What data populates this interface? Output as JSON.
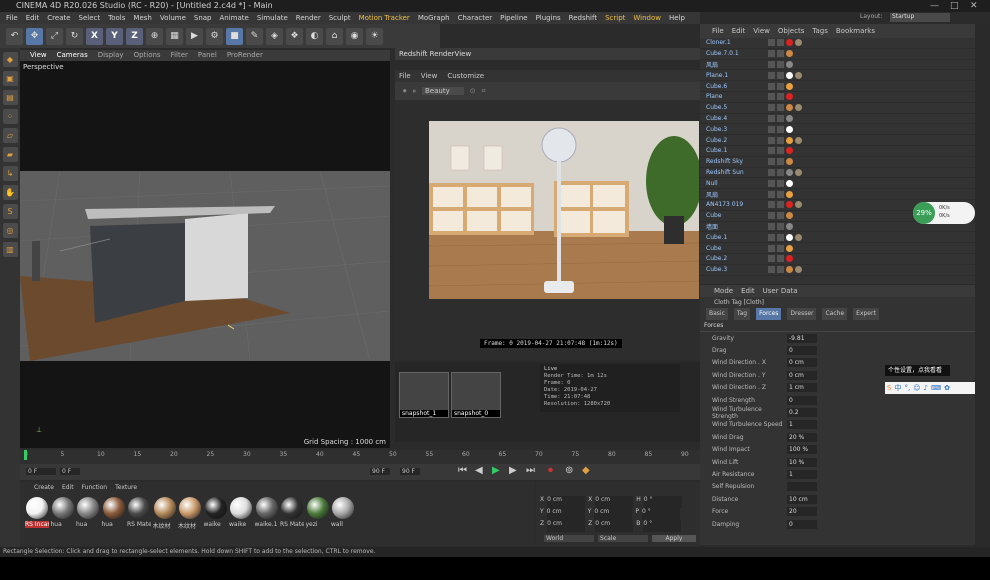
{
  "window": {
    "title": "CINEMA 4D R20.026 Studio (RC - R20) - [Untitled 2.c4d *] - Main",
    "layout_label": "Layout:",
    "layout_value": "Startup"
  },
  "menu": [
    "File",
    "Edit",
    "Create",
    "Select",
    "Tools",
    "Mesh",
    "Volume",
    "Snap",
    "Animate",
    "Simulate",
    "Render",
    "Sculpt",
    "Motion Tracker",
    "MoGraph",
    "Character",
    "Pipeline",
    "Plugins",
    "Redshift",
    "Script",
    "Window",
    "Help"
  ],
  "viewport": {
    "menu": [
      "View",
      "Cameras",
      "Display",
      "Options",
      "Filter",
      "Panel",
      "ProRender"
    ],
    "label": "Perspective",
    "grid_spacing": "Grid Spacing : 1000 cm"
  },
  "renderview": {
    "title": "Redshift RenderView",
    "menu": [
      "File",
      "View",
      "Customize"
    ],
    "preset": "Beauty",
    "frame_info": "Frame:  0   2019-04-27  21:07:48   (1m:12s)"
  },
  "snapshots": [
    {
      "label": "snapshot_1"
    },
    {
      "label": "snapshot_0"
    }
  ],
  "log": {
    "title": "Live",
    "lines": [
      "Render Time: 1m 12s",
      "Frame: 0",
      "Date: 2019-04-27",
      "Time: 21:07:48",
      "Resolution: 1280x720"
    ]
  },
  "objects": {
    "tabs": [
      "File",
      "Edit",
      "View",
      "Objects",
      "Tags",
      "Bookmarks"
    ],
    "items": [
      "Cloner.1",
      "Cube.7.0.1",
      "风扇",
      "Plane.1",
      "Cube.6",
      "Plane",
      "Cube.5",
      "Cube.4",
      "Cube.3",
      "Cube.2",
      "Cube.1",
      "Redshift Sky",
      "Redshift Sun",
      "Null",
      "风扇",
      "AN4173 019",
      "Cube",
      "墙面",
      "Cube.1",
      "Cube",
      "Cube.2",
      "Cube.3"
    ]
  },
  "attributes": {
    "menu": [
      "Mode",
      "Edit",
      "User Data"
    ],
    "tag_title": "Cloth Tag [Cloth]",
    "tabs": [
      "Basic",
      "Tag",
      "Forces",
      "Dresser",
      "Cache",
      "Expert"
    ],
    "active_tab": "Forces",
    "section": "Forces",
    "rows": [
      {
        "label": "Gravity",
        "value": "-9.81"
      },
      {
        "label": "Drag",
        "value": "0"
      },
      {
        "label": "Wind Direction . X",
        "value": "0 cm"
      },
      {
        "label": "Wind Direction . Y",
        "value": "0 cm"
      },
      {
        "label": "Wind Direction . Z",
        "value": "1 cm"
      },
      {
        "label": "Wind Strength",
        "value": "0"
      },
      {
        "label": "Wind Turbulence Strength",
        "value": "0.2"
      },
      {
        "label": "Wind Turbulence Speed",
        "value": "1"
      },
      {
        "label": "Wind Drag",
        "value": "20 %"
      },
      {
        "label": "Wind Impact",
        "value": "100 %"
      },
      {
        "label": "Wind Lift",
        "value": "10 %"
      },
      {
        "label": "Air Resistance",
        "value": "1"
      },
      {
        "label": "Self Repulsion",
        "value": ""
      },
      {
        "label": "Distance",
        "value": "10 cm"
      },
      {
        "label": "Force",
        "value": "20"
      },
      {
        "label": "Damping",
        "value": "0"
      }
    ]
  },
  "timeline": {
    "ticks": [
      "0",
      "5",
      "10",
      "15",
      "20",
      "25",
      "30",
      "35",
      "40",
      "45",
      "50",
      "55",
      "60",
      "65",
      "70",
      "75",
      "80",
      "85",
      "90"
    ],
    "start": "0 F",
    "current": "0 F",
    "end": "90 F",
    "end2": "90 F"
  },
  "materials": {
    "menu": [
      "Create",
      "Edit",
      "Function",
      "Texture"
    ],
    "items": [
      "RS Incan",
      "hua",
      "hua",
      "hua",
      "RS Mate",
      "木纹材",
      "木纹材",
      "waike",
      "waike",
      "waike.1",
      "RS Mate",
      "yezi",
      "wall"
    ]
  },
  "coords": {
    "rows": [
      [
        "X",
        "0 cm",
        "X",
        "0 cm",
        "H",
        "0 °"
      ],
      [
        "Y",
        "0 cm",
        "Y",
        "0 cm",
        "P",
        "0 °"
      ],
      [
        "Z",
        "0 cm",
        "Z",
        "0 cm",
        "B",
        "0 °"
      ]
    ],
    "mode1": "World",
    "mode2": "Scale",
    "apply": "Apply"
  },
  "status": "Rectangle Selection: Click and drag to rectangle-select elements. Hold down SHIFT to add to the selection, CTRL to remove.",
  "overlay": {
    "gauge": "29%",
    "net_up": "0K/s",
    "net_down": "0K/s",
    "tooltip": "个性设置，点我看看",
    "ime_lang": "中"
  },
  "colors": {
    "accent": "#5778a6",
    "highlight": "#f0c040",
    "gauge": "#3a9e56"
  }
}
